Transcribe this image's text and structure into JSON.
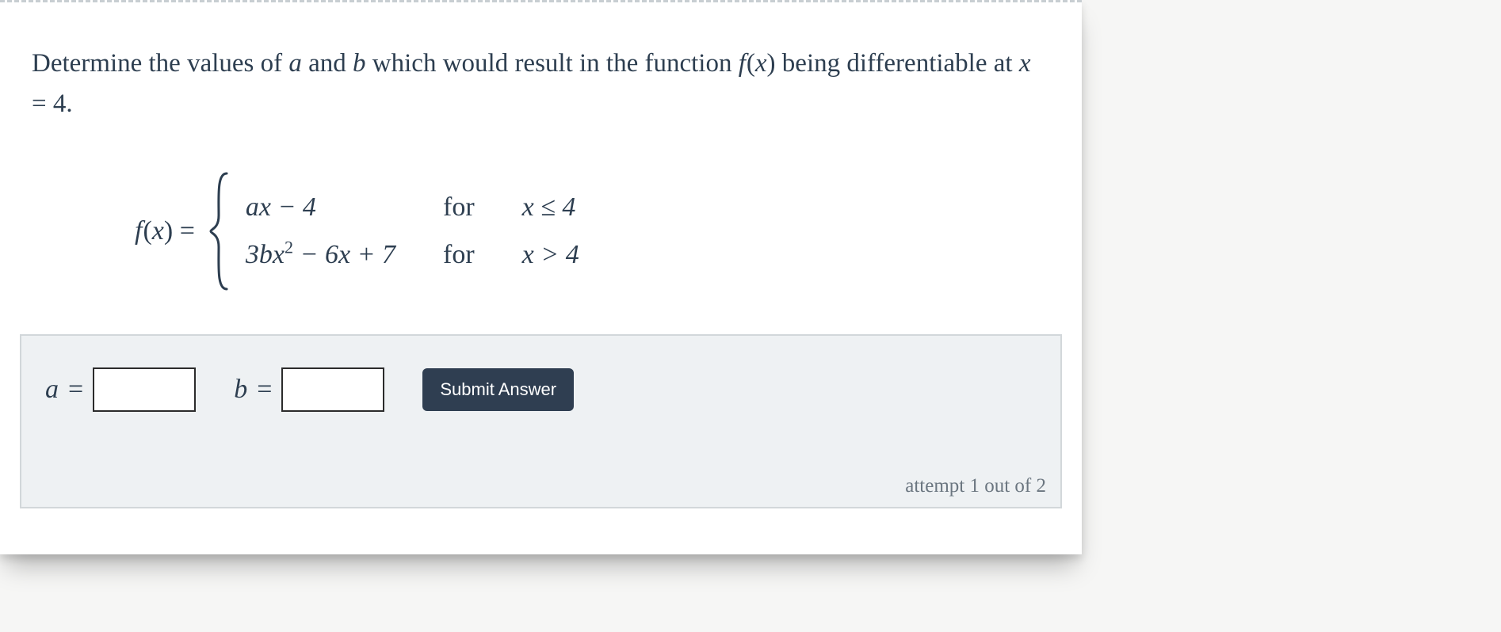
{
  "prompt": {
    "text_before_a": "Determine the values of ",
    "var_a": "a",
    "text_between_a_b": " and ",
    "var_b": "b",
    "text_after_b": " which would result in the function ",
    "fn_name": "f",
    "fn_var": "x",
    "text_after_fn": " being differentiable at ",
    "cond_var": "x",
    "cond_eq": " = ",
    "cond_val": "4",
    "period": "."
  },
  "equation": {
    "lhs_fn": "f",
    "lhs_var": "x",
    "eq": " = ",
    "case1_expr": "ax − 4",
    "case2_expr_pre": "3bx",
    "case2_exp": "2",
    "case2_expr_post": " − 6x + 7",
    "for_label": "for",
    "case1_cond": "x ≤ 4",
    "case2_cond": "x > 4"
  },
  "answer": {
    "label_a": "a",
    "label_b": "b",
    "eq": " = ",
    "value_a": "",
    "value_b": "",
    "submit_label": "Submit Answer",
    "attempt_text": "attempt 1 out of 2"
  }
}
